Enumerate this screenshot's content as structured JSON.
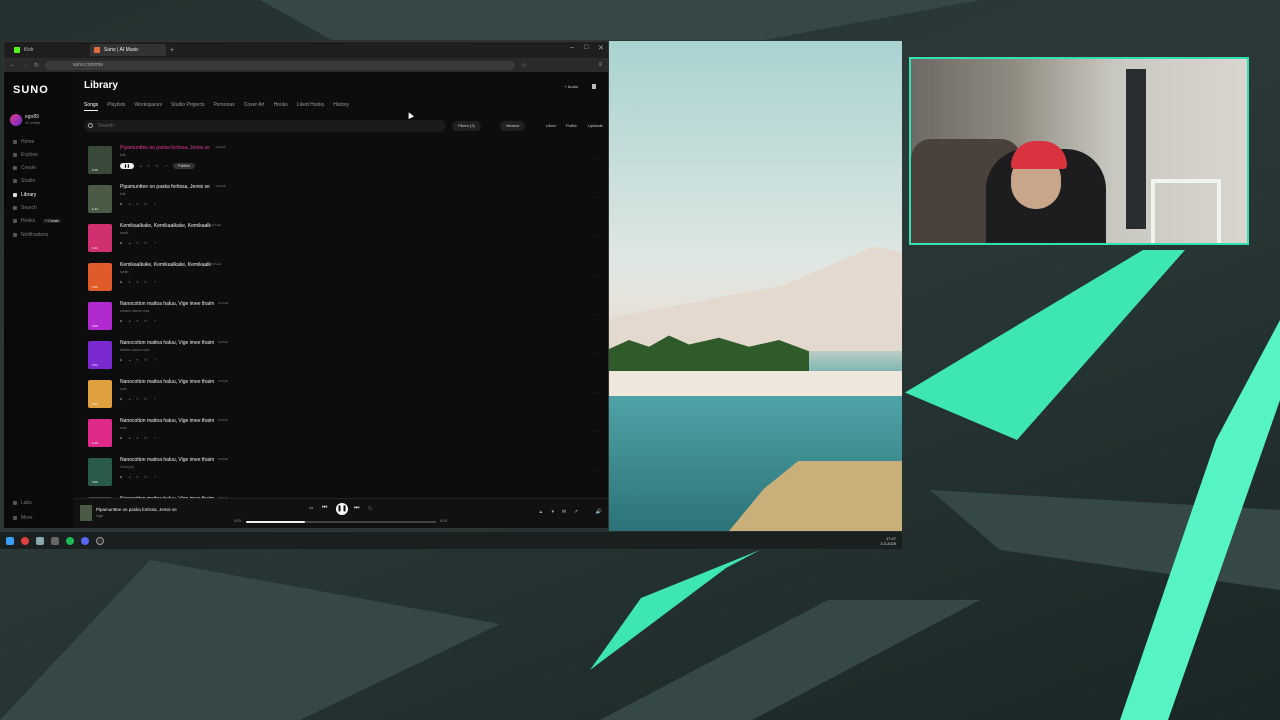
{
  "browser": {
    "tabs": [
      {
        "label": "Kick"
      },
      {
        "label": "Suno | AI Music"
      }
    ],
    "url": "suno.com/me"
  },
  "sidebar": {
    "logo": "SUNO",
    "user_name": "ego89",
    "user_credits": "50 credits",
    "items": [
      {
        "label": "Home"
      },
      {
        "label": "Explore"
      },
      {
        "label": "Create"
      },
      {
        "label": "Studio"
      },
      {
        "label": "Library"
      },
      {
        "label": "Search"
      },
      {
        "label": "Hooks"
      },
      {
        "label": "Notifications"
      }
    ],
    "hooks_badge": "+ Create",
    "bottom_items": [
      {
        "label": "Labs"
      },
      {
        "label": "More"
      }
    ]
  },
  "library": {
    "title": "Library",
    "add_audio": "+ Audio",
    "tabs": [
      "Songs",
      "Playlists",
      "Workspaces",
      "Studio Projects",
      "Personas",
      "Cover Art",
      "Hooks",
      "Liked Hooks",
      "History"
    ],
    "search_placeholder": "Search",
    "filters": "Filters (3)",
    "sort": "Newest",
    "liked": "Liked",
    "public": "Public",
    "uploads": "Uploads",
    "publish": "Publish"
  },
  "songs": [
    {
      "title": "Pipamunttee on paska fortissa, Jemis se",
      "version": "v4.5-all",
      "tags": "folk",
      "duration": "0:15",
      "color": "#3a4a3a",
      "playing": true
    },
    {
      "title": "Pipamunttee on paska fortissa, Jemis se",
      "version": "v4.5-all",
      "tags": "folk",
      "duration": "1:14",
      "color": "#4a5a44"
    },
    {
      "title": "Kemikaalkake, Kemikaalkake, Kemikaalk",
      "version": "v4.5-all",
      "tags": "synth",
      "duration": "1:21",
      "color": "#d0306f"
    },
    {
      "title": "Kemikaalkake, Kemikaalkake, Kemikaalk",
      "version": "v4.5-all",
      "tags": "synth",
      "duration": "0:56",
      "color": "#e05a2a"
    },
    {
      "title": "Nanocotton maitoa haluu, Vige imee thaim",
      "version": "v4.5-all",
      "tags": "electric dance-rock",
      "duration": "3:00",
      "color": "#b02ad0"
    },
    {
      "title": "Nanocotton maitoa haluu, Vige imee thaim",
      "version": "v4.5-all",
      "tags": "electric dance-rock",
      "duration": "3:01",
      "color": "#7a2ad0"
    },
    {
      "title": "Nanocotton maitoa haluu, Vige imee thaim",
      "version": "v4.5-all",
      "tags": "rock",
      "duration": "2:44",
      "color": "#e0a040"
    },
    {
      "title": "Nanocotton maitoa haluu, Vige imee thaim",
      "version": "v4.5-all",
      "tags": "rock",
      "duration": "1:20",
      "color": "#e02a8a"
    },
    {
      "title": "Nanocotton maitoa haluu, Vige imee thaim",
      "version": "v4.5-all",
      "tags": "Goat psy",
      "duration": "3:00",
      "color": "#2a5a4a"
    },
    {
      "title": "Nanocotton maitoa haluu, Vige imee thaim",
      "version": "v4.5-all",
      "tags": "",
      "duration": "",
      "color": "#444"
    }
  ],
  "player": {
    "title": "Pipamunttee on paska fortissa, Jemis se",
    "artist": "Vige",
    "elapsed": "0:03",
    "total": "0:15",
    "progress": 0.31
  },
  "taskbar": {
    "time": "17:47",
    "date": "3.3.2025"
  },
  "colors": {
    "accent": "#3ee6b4",
    "highlight": "#e0358f"
  }
}
